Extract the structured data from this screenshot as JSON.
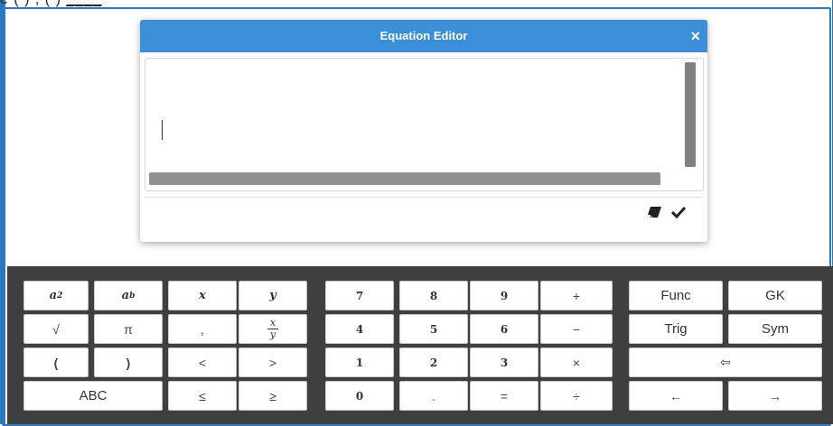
{
  "top_fragment": {
    "left": "e",
    "mid": "( ) ; ( )",
    "underlined": "____"
  },
  "editor": {
    "title": "Equation Editor",
    "close_glyph": "×",
    "clear_icon": "eraser-icon",
    "accept_icon": "check-icon"
  },
  "keypad": {
    "math": {
      "row1": [
        "a",
        "a",
        "x",
        "y"
      ],
      "superscripts": {
        "power2": "2",
        "powerb": "b"
      },
      "row2": [
        "√",
        "π",
        ",",
        "x/y"
      ],
      "fraction": {
        "num": "x",
        "den": "y"
      },
      "row3": [
        "(",
        ")",
        "<",
        ">"
      ],
      "row4": [
        "ABC",
        "≤",
        "≥"
      ]
    },
    "numbers": {
      "row1": [
        "7",
        "8",
        "9",
        "+"
      ],
      "row2": [
        "4",
        "5",
        "6",
        "−"
      ],
      "row3": [
        "1",
        "2",
        "3",
        "×"
      ],
      "row4": [
        "0",
        ".",
        "=",
        "÷"
      ]
    },
    "functions": {
      "row1": [
        "Func",
        "GK"
      ],
      "row2": [
        "Trig",
        "Sym"
      ],
      "backspace": "⇦",
      "left": "←",
      "right": "→"
    }
  },
  "colors": {
    "titlebar": "#3a8fd8",
    "frame": "#2b78c2",
    "keyboard_bg": "#3f3f3f"
  }
}
